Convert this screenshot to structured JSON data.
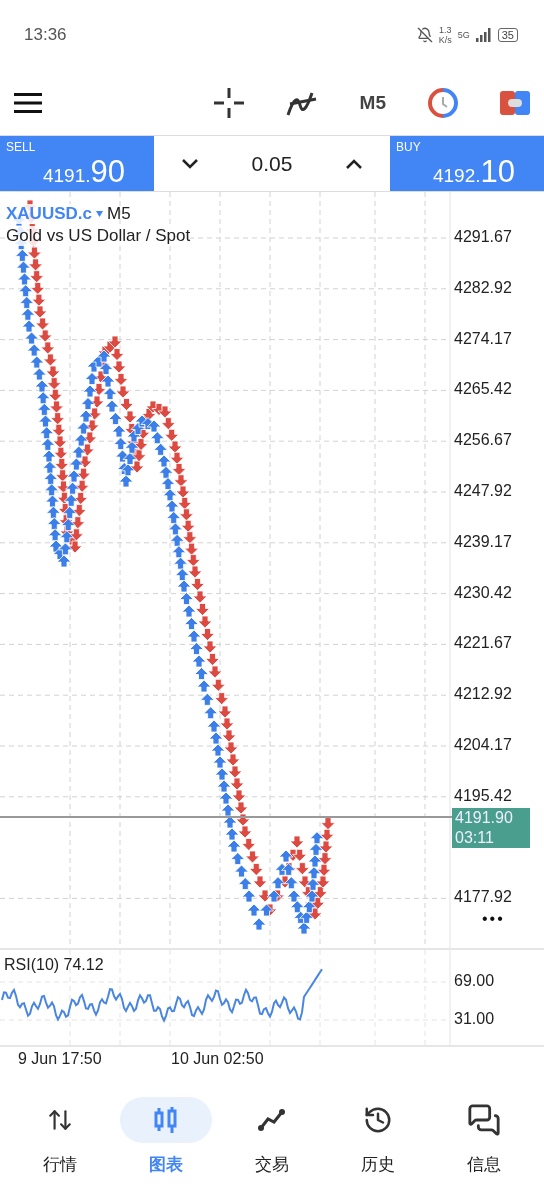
{
  "status_bar": {
    "time": "13:36",
    "speed_value": "1.3",
    "speed_unit": "K/s",
    "network": "5G",
    "battery": "35"
  },
  "toolbar": {
    "timeframe": "M5"
  },
  "trade_bar": {
    "sell_label": "SELL",
    "sell_price_main": "4191.",
    "sell_price_big": "90",
    "lot": "0.05",
    "buy_label": "BUY",
    "buy_price_main": "4192.",
    "buy_price_big": "10"
  },
  "chart": {
    "symbol": "XAUUSD.c",
    "timeframe": "M5",
    "description": "Gold vs US Dollar / Spot",
    "price_labels": [
      "4291.67",
      "4282.92",
      "4274.17",
      "4265.42",
      "4256.67",
      "4247.92",
      "4239.17",
      "4230.42",
      "4221.67",
      "4212.92",
      "4204.17",
      "4195.42",
      "4177.92"
    ],
    "current_price": "4191.90",
    "countdown": "03:11",
    "more": "•••"
  },
  "rsi": {
    "title": "RSI(10) 74.12",
    "levels": [
      "69.00",
      "31.00"
    ]
  },
  "time_labels": [
    "9 Jun 17:50",
    "10 Jun 02:50"
  ],
  "nav": [
    {
      "label": "行情",
      "kind": "quotes",
      "selected": false
    },
    {
      "label": "图表",
      "kind": "chart",
      "selected": true
    },
    {
      "label": "交易",
      "kind": "trade",
      "selected": false
    },
    {
      "label": "历史",
      "kind": "history",
      "selected": false
    },
    {
      "label": "信息",
      "kind": "messages",
      "selected": false
    }
  ]
}
